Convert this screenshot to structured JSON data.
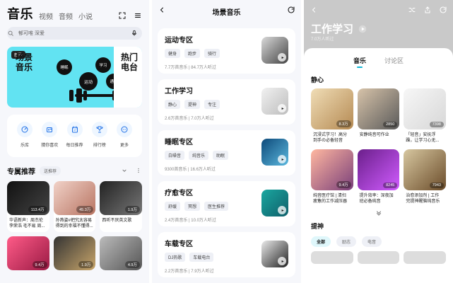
{
  "colors": {
    "accent": "#11b6d6",
    "banner": "#62e3f2",
    "bg": "#f6f7fb",
    "chip_bg": "#eef0f6"
  },
  "panel1": {
    "brand": "音乐",
    "tabs": [
      "视频",
      "音频",
      "小说"
    ],
    "search_placeholder": "郁可唯 深爱",
    "banner": {
      "tag": "新歌",
      "title_line1": "场景",
      "title_line2": "音乐",
      "right_title_line1": "热门",
      "right_title_line2": "电台",
      "bubbles": [
        "睡眠",
        "学习",
        "运动",
        "通勤"
      ]
    },
    "quick_links": [
      {
        "label": "乐库",
        "icon": "music-library-icon"
      },
      {
        "label": "猜你喜欢",
        "icon": "radio-icon"
      },
      {
        "label": "每日推荐",
        "icon": "calendar-icon"
      },
      {
        "label": "排行榜",
        "icon": "trophy-icon"
      },
      {
        "label": "更多",
        "icon": "more-icon"
      }
    ],
    "recommend": {
      "title": "专属推荐",
      "chip": "送推荐",
      "items": [
        {
          "text": "华语新声：周杰伦 李荣浩 毛不易 周...",
          "plays": "113.4万"
        },
        {
          "text": "孙燕姿#把究太容易 得到的幸福不懂得...",
          "plays": "45.3万"
        },
        {
          "text": "西听不厌英文歌",
          "plays": "1.9万"
        },
        {
          "text": "",
          "plays": "9.4万"
        },
        {
          "text": "",
          "plays": "1.9万"
        },
        {
          "text": "",
          "plays": "4.9万"
        }
      ]
    }
  },
  "panel2": {
    "title": "场景音乐",
    "sections": [
      {
        "title": "运动专区",
        "tags": [
          "健身",
          "跑步",
          "骑行"
        ],
        "meta": "7.7万首音乐 | 84.7万人听过"
      },
      {
        "title": "工作学习",
        "tags": [
          "静心",
          "提神",
          "专注"
        ],
        "meta": "2.6万首音乐 | 7.0万人听过"
      },
      {
        "title": "睡眠专区",
        "tags": [
          "白噪音",
          "纯音乐",
          "助眠"
        ],
        "meta": "9300首音乐 | 16.6万人听过"
      },
      {
        "title": "疗愈专区",
        "tags": [
          "舒缓",
          "冥想",
          "医生推荐"
        ],
        "meta": "2.4万首音乐 | 10.0万人听过"
      },
      {
        "title": "车载专区",
        "tags": [
          "DJ热歌",
          "车载电台"
        ],
        "meta": "2.2万首音乐 | 7.9万人听过"
      }
    ]
  },
  "panel3": {
    "title": "工作学习",
    "subtitle": "7.0万人听过",
    "tabs": [
      "音乐",
      "讨论区"
    ],
    "section1": "静心",
    "grid": [
      {
        "text": "沉浸式学习！高分 到手の必备轻音",
        "plays": "8.3万"
      },
      {
        "text": "安静纯音可作业",
        "plays": "2850"
      },
      {
        "text": "「轻音」安抚浮 躁，让学习心无...",
        "plays": "7398"
      },
      {
        "text": "纯音医疗馆 | 清扫 疲惫的工作减压器",
        "plays": "9.4万"
      },
      {
        "text": "提升效率：深夜加 班必备纯音",
        "plays": "8245"
      },
      {
        "text": "治愈添加剂 | 工作 完提神醒脑纯音乐",
        "plays": "7943"
      }
    ],
    "section2": "提神",
    "chips": [
      "全部",
      "励志",
      "电音"
    ]
  }
}
